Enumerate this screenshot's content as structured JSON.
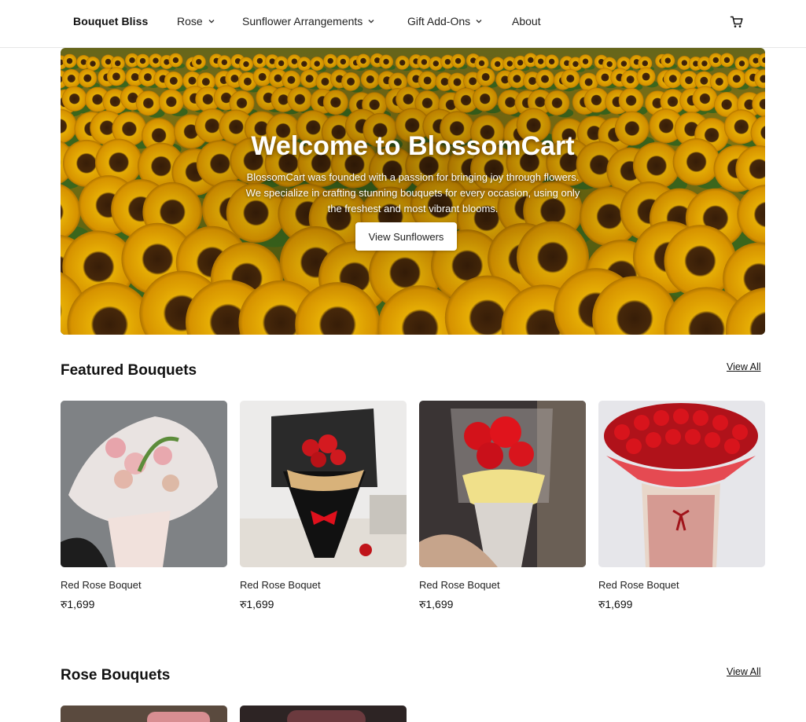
{
  "nav": {
    "brand": "Bouquet Bliss",
    "items": [
      {
        "label": "Rose",
        "has_dropdown": true
      },
      {
        "label": "Sunflower Arrangements",
        "has_dropdown": true
      },
      {
        "label": "Gift Add-Ons",
        "has_dropdown": true
      },
      {
        "label": "About",
        "has_dropdown": false
      }
    ],
    "cart_icon": "cart-icon"
  },
  "hero": {
    "title": "Welcome to BlossomCart",
    "description": "BlossomCart was founded with a passion for bringing joy through flowers. We specialize in crafting stunning bouquets for every occasion, using only the freshest and most vibrant blooms.",
    "button_label": "View Sunflowers"
  },
  "featured": {
    "title": "Featured Bouquets",
    "view_all": "View All",
    "products": [
      {
        "name": "Red Rose Boquet",
        "price": "रु1,699"
      },
      {
        "name": "Red Rose Boquet",
        "price": "रु1,699"
      },
      {
        "name": "Red Rose Boquet",
        "price": "रु1,699"
      },
      {
        "name": "Red Rose Boquet",
        "price": "रु1,699"
      }
    ]
  },
  "rose": {
    "title": "Rose Bouquets",
    "view_all": "View All"
  },
  "colors": {
    "text": "#111111",
    "border": "#e6e6e6",
    "sunflower": "#f2b705"
  }
}
